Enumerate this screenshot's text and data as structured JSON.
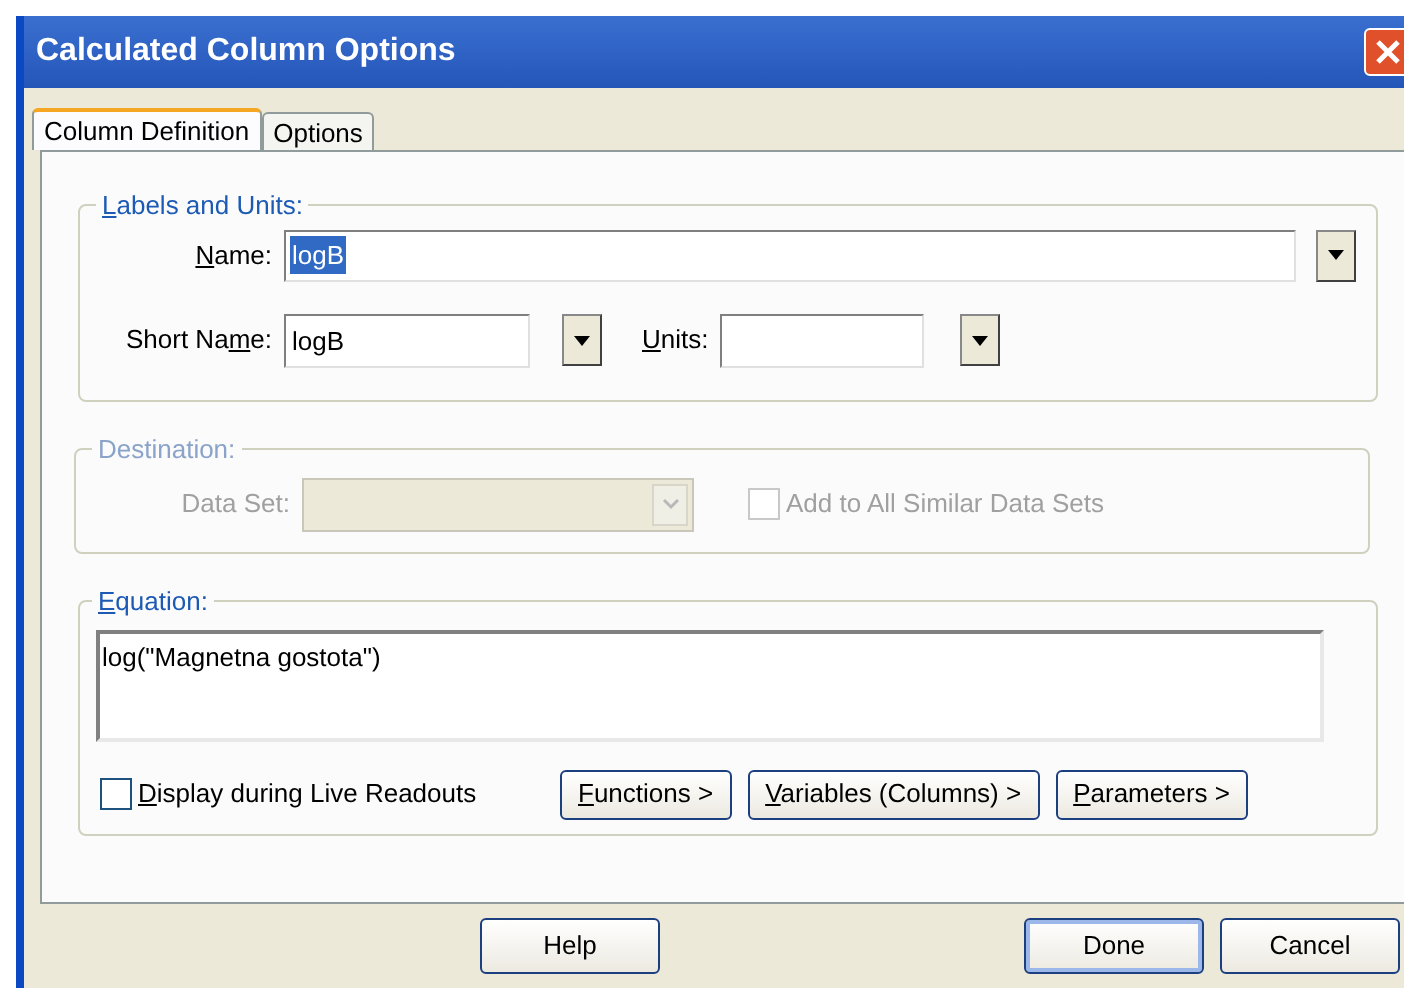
{
  "window": {
    "title": "Calculated Column Options"
  },
  "tabs": [
    {
      "label": "Column Definition",
      "selected": true
    },
    {
      "label": "Options",
      "selected": false
    }
  ],
  "labels_and_units": {
    "title": {
      "key": "L",
      "post": "abels and Units:"
    },
    "name": {
      "label": {
        "key": "N",
        "post": "ame:"
      },
      "value": "logB",
      "text_selected": true
    },
    "short_name": {
      "label": {
        "pre": "Short Na",
        "key": "m",
        "post": "e:"
      },
      "value": "logB"
    },
    "units": {
      "label": {
        "key": "U",
        "post": "nits:"
      }
    }
  },
  "destination": {
    "title": "Destination:",
    "disabled": true,
    "data_set_label": "Data Set:",
    "add_to_all": {
      "label": "Add to All Similar Data Sets",
      "checked": false
    }
  },
  "equation": {
    "title": {
      "key": "E",
      "post": "quation:"
    },
    "value": "log(\"Magnetna gostota\")",
    "display_live": {
      "label": {
        "key": "D",
        "post": "isplay during Live Readouts"
      },
      "checked": false
    },
    "buttons": [
      {
        "label": {
          "key": "F",
          "post": "unctions >"
        }
      },
      {
        "label": {
          "key": "V",
          "post": "ariables (Columns) >"
        }
      },
      {
        "label": {
          "key": "P",
          "post": "arameters >"
        }
      }
    ]
  },
  "buttons": [
    {
      "label": "Help",
      "default": false
    },
    {
      "label": "Done",
      "default": true
    },
    {
      "label": "Cancel",
      "default": false
    }
  ]
}
